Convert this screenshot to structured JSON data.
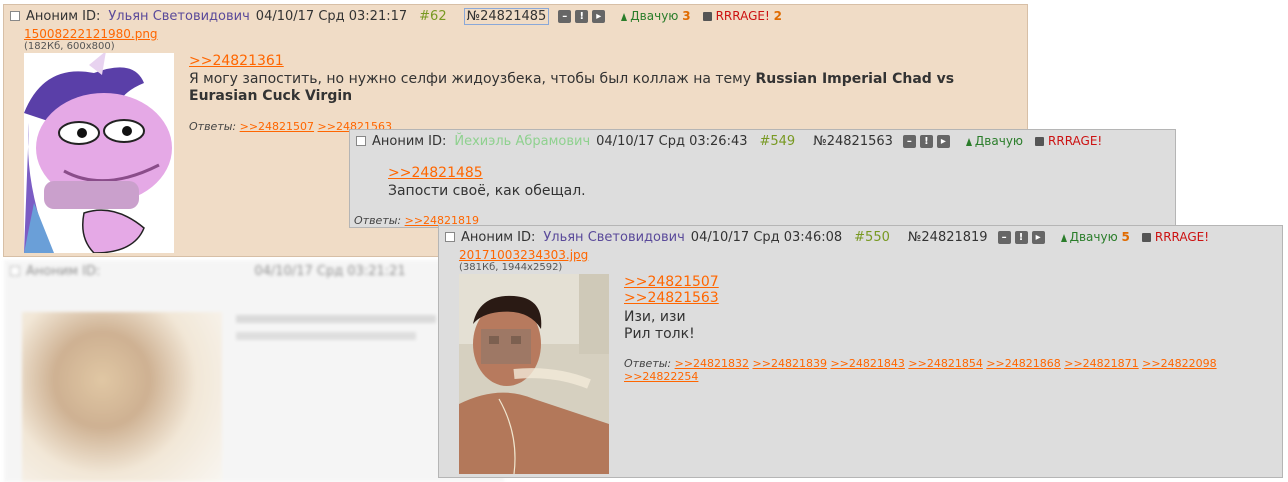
{
  "post1": {
    "anon": "Аноним",
    "id_label": "ID:",
    "id_name": "Ульян Световидович",
    "date": "04/10/17 Срд 03:21:17",
    "num": "#62",
    "no": "№24821485",
    "like_label": "Двачую",
    "like_count": "3",
    "dislike_label": "RRRAGE!",
    "dislike_count": "2",
    "file_name": "15008222121980.png",
    "file_meta": "(182Кб, 600x800)",
    "quote_link": ">>24821361",
    "text_plain": "Я могу запостить, но нужно селфи жидоузбека, чтобы был коллаж на тему ",
    "text_bold": "Russian Imperial Chad vs Eurasian Cuck Virgin",
    "replies_label": "Ответы:",
    "replies": [
      ">>24821507",
      ">>24821563"
    ]
  },
  "post2": {
    "anon": "Аноним",
    "id_label": "ID:",
    "id_name": "Йехиэль Абрамович",
    "date": "04/10/17 Срд 03:26:43",
    "num": "#549",
    "no": "№24821563",
    "like_label": "Двачую",
    "dislike_label": "RRRAGE!",
    "quote_link": ">>24821485",
    "text": "Запости своё, как обещал.",
    "replies_label": "Ответы:",
    "replies": [
      ">>24821819"
    ]
  },
  "post3": {
    "anon": "Аноним",
    "id_label": "ID:",
    "id_name": "Ульян Световидович",
    "date": "04/10/17 Срд 03:46:08",
    "num": "#550",
    "no": "№24821819",
    "like_label": "Двачую",
    "like_count": "5",
    "dislike_label": "RRRAGE!",
    "file_name": "20171003234303.jpg",
    "file_meta": "(381Кб, 1944x2592)",
    "quote_links": [
      ">>24821507",
      ">>24821563"
    ],
    "line1": "Изи, изи",
    "line2": "Рил толк!",
    "replies_label": "Ответы:",
    "replies": [
      ">>24821832",
      ">>24821839",
      ">>24821843",
      ">>24821854",
      ">>24821868",
      ">>24821871",
      ">>24822098",
      ">>24822254"
    ]
  },
  "bg_post": {
    "anon": "Аноним",
    "id_label": "ID:",
    "date": "04/10/17 Срд 03:21:21"
  },
  "colors": {
    "post1_bg": "#f0dcc6",
    "post_bg": "#dddddd",
    "accent_link": "#ff6600",
    "id_color": "#5a4a9a",
    "green_id": "#8fd18f",
    "num_green": "#789922"
  }
}
